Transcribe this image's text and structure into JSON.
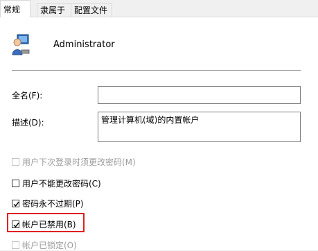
{
  "tabs": [
    {
      "label": "常规",
      "active": true
    },
    {
      "label": "隶属于",
      "active": false
    },
    {
      "label": "配置文件",
      "active": false
    }
  ],
  "user": {
    "name": "Administrator",
    "icon": "user-computer-icon"
  },
  "fields": {
    "fullname_label": "全名(F):",
    "fullname_value": "",
    "description_label": "描述(D):",
    "description_value": "管理计算机(域)的内置帐户"
  },
  "options": [
    {
      "label": "用户下次登录时须更改密码(M)",
      "checked": false,
      "disabled": true
    },
    {
      "label": "用户不能更改密码(C)",
      "checked": false,
      "disabled": false
    },
    {
      "label": "密码永不过期(P)",
      "checked": true,
      "disabled": false
    },
    {
      "label": "帐户已禁用(B)",
      "checked": true,
      "disabled": false
    },
    {
      "label": "帐户已锁定(O)",
      "checked": false,
      "disabled": true
    }
  ],
  "colors": {
    "highlight": "#e02020",
    "accent": "#333333"
  }
}
